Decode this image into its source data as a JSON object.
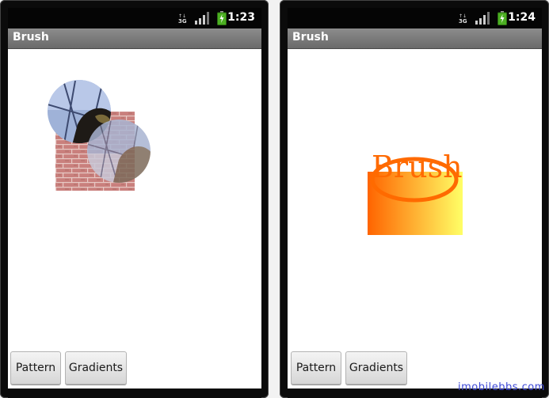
{
  "screens": [
    {
      "time": "1:23",
      "title": "Brush",
      "buttons": {
        "pattern": "Pattern",
        "gradients": "Gradients"
      }
    },
    {
      "time": "1:24",
      "title": "Brush",
      "buttons": {
        "pattern": "Pattern",
        "gradients": "Gradients"
      },
      "canvas_text": "Brush"
    }
  ],
  "status_icons": [
    "3g-icon",
    "signal-icon",
    "battery-icon"
  ],
  "colors": {
    "gradient_start": "#ff6400",
    "gradient_end": "#ffff66",
    "brush_text": "#ff6a00"
  },
  "watermark": "imobilebbs.com"
}
